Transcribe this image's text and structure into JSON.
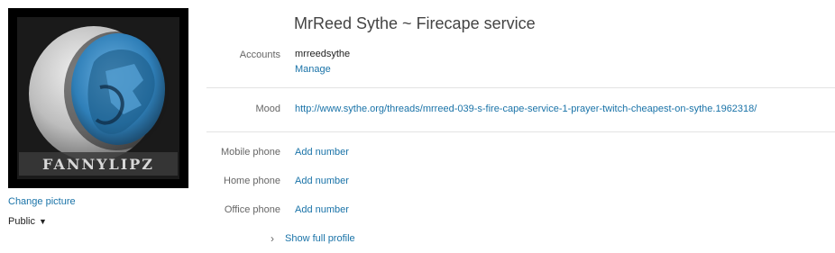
{
  "profile": {
    "display_name": "MrReed Sythe ~ Firecape service",
    "avatar_text": "FANNYLIPZ",
    "change_picture_label": "Change picture",
    "privacy_label": "Public",
    "privacy_caret": "▼"
  },
  "fields": {
    "accounts": {
      "label": "Accounts",
      "value": "mrreedsythe",
      "action": "Manage"
    },
    "mood": {
      "label": "Mood",
      "value": "http://www.sythe.org/threads/mrreed-039-s-fire-cape-service-1-prayer-twitch-cheapest-on-sythe.1962318/"
    },
    "mobile": {
      "label": "Mobile phone",
      "value": "Add number"
    },
    "home": {
      "label": "Home phone",
      "value": "Add number"
    },
    "office": {
      "label": "Office phone",
      "value": "Add number"
    }
  },
  "show_full": {
    "chevron": "›",
    "label": "Show full profile"
  },
  "colors": {
    "link": "#1a73a8",
    "label": "#666666",
    "divider": "#e3e3e3",
    "avatar_blue": "#3f8fc9"
  }
}
